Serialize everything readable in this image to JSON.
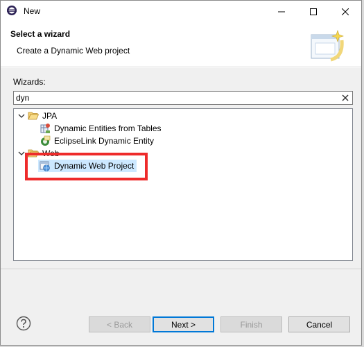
{
  "window": {
    "title": "New"
  },
  "banner": {
    "title": "Select a wizard",
    "subtitle": "Create a Dynamic Web project"
  },
  "wizards_label": "Wizards:",
  "filter": {
    "value": "dyn"
  },
  "tree": {
    "groups": [
      {
        "label": "JPA",
        "expanded": true,
        "items": [
          {
            "label": "Dynamic Entities from Tables",
            "icon": "jpa-entities-icon"
          },
          {
            "label": "EclipseLink Dynamic Entity",
            "icon": "eclipselink-entity-icon"
          }
        ]
      },
      {
        "label": "Web",
        "expanded": true,
        "items": [
          {
            "label": "Dynamic Web Project",
            "icon": "web-project-icon",
            "selected": true
          }
        ]
      }
    ]
  },
  "buttons": {
    "back": "< Back",
    "next": "Next >",
    "finish": "Finish",
    "cancel": "Cancel"
  },
  "colors": {
    "selection": "#cce8ff",
    "highlight": "#ee2b2b",
    "folder": "#e8b64c"
  }
}
